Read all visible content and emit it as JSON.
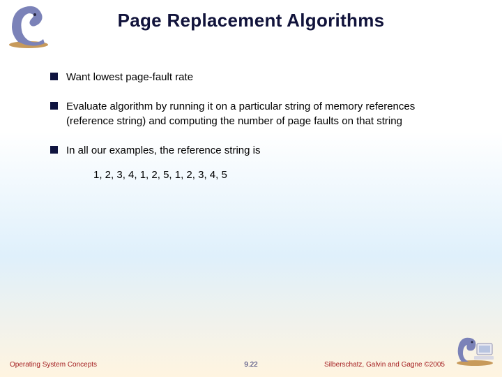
{
  "title": "Page Replacement Algorithms",
  "bullets": {
    "b1": "Want lowest page-fault rate",
    "b2": "Evaluate algorithm by running it on a particular string of memory references (reference string) and computing the number of page faults on that string",
    "b3": "In all our examples, the reference string is"
  },
  "reference_string": "1, 2, 3, 4, 1, 2, 5, 1, 2, 3, 4, 5",
  "footer": {
    "left": "Operating System Concepts",
    "mid": "9.22",
    "right": "Silberschatz, Galvin and Gagne ©2005"
  }
}
